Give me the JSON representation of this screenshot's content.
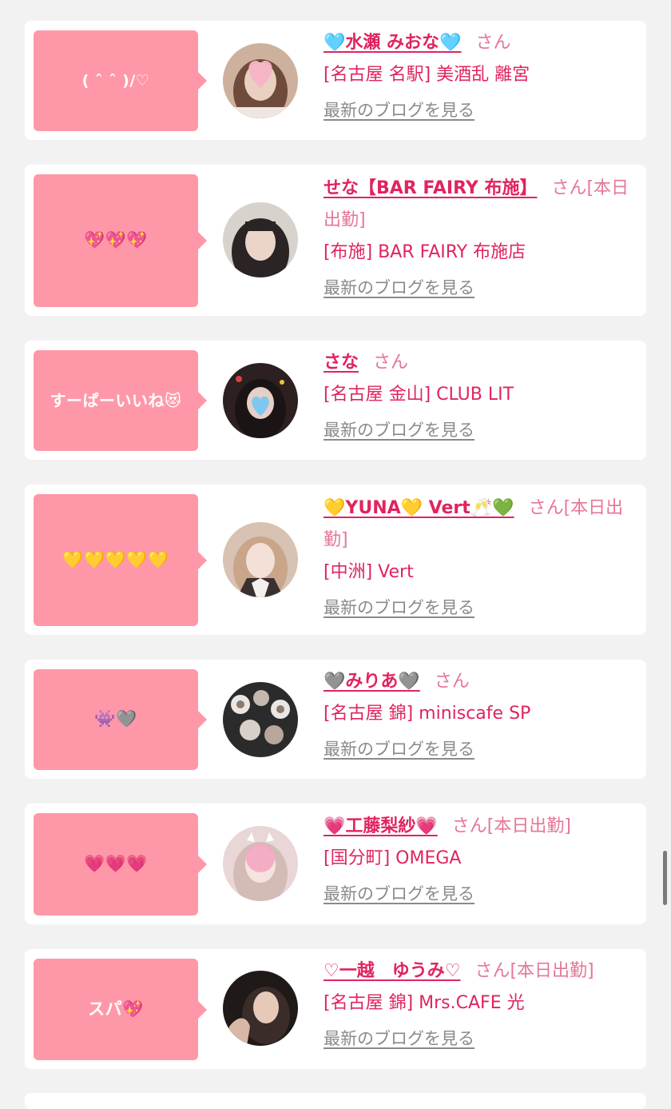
{
  "entries": [
    {
      "comment": "( ˆ ˆ )/♡",
      "name": "🩵水瀬 みおな🩵",
      "honorific": "さん",
      "shop": "[名古屋 名駅] 美酒乱 離宮",
      "blog_link": "最新のブログを見る",
      "avatar_colors": [
        "#c9a58e",
        "#6e4b3a",
        "#f7c6d3"
      ]
    },
    {
      "comment": "💖💖💖",
      "name": "せな【BAR FAIRY 布施】",
      "honorific": "さん[本日出勤]",
      "shop": "[布施] BAR FAIRY 布施店",
      "blog_link": "最新のブログを見る",
      "avatar_colors": [
        "#dcd6d2",
        "#2a2424",
        "#e8d2c6"
      ]
    },
    {
      "comment": "すーぱーいいね😻",
      "name": "さな",
      "honorific": "さん",
      "shop": "[名古屋 金山] CLUB LIT",
      "blog_link": "最新のブログを見る",
      "avatar_colors": [
        "#3a2a2a",
        "#1b1414",
        "#7cc8f0"
      ]
    },
    {
      "comment": "💛💛💛💛💛",
      "name": "💛YUNA💛 Vert🥂💚",
      "honorific": "さん[本日出勤]",
      "shop": "[中洲] Vert",
      "blog_link": "最新のブログを見る",
      "avatar_colors": [
        "#c9a58a",
        "#f1ddd0",
        "#3b3030"
      ]
    },
    {
      "comment": "👾🩶",
      "name": "🩶みりあ🩶",
      "honorific": "さん",
      "shop": "[名古屋 錦] miniscafe SP",
      "blog_link": "最新のブログを見る",
      "avatar_colors": [
        "#2b2b2b",
        "#e9e6e4",
        "#b8a69b"
      ]
    },
    {
      "comment": "💗💗💗",
      "name": "💗工藤梨紗💗",
      "honorific": "さん[本日出勤]",
      "shop": "[国分町] OMEGA",
      "blog_link": "最新のブログを見る",
      "avatar_colors": [
        "#e9d6d6",
        "#f3a7c2",
        "#cfc0bc"
      ]
    },
    {
      "comment": "スパ💖",
      "name": "♡一越　ゆうみ♡",
      "honorific": "さん[本日出勤]",
      "shop": "[名古屋 錦] Mrs.CAFE 光",
      "blog_link": "最新のブログを見る",
      "avatar_colors": [
        "#3a2c28",
        "#d9b7a7",
        "#1f1917"
      ]
    }
  ]
}
